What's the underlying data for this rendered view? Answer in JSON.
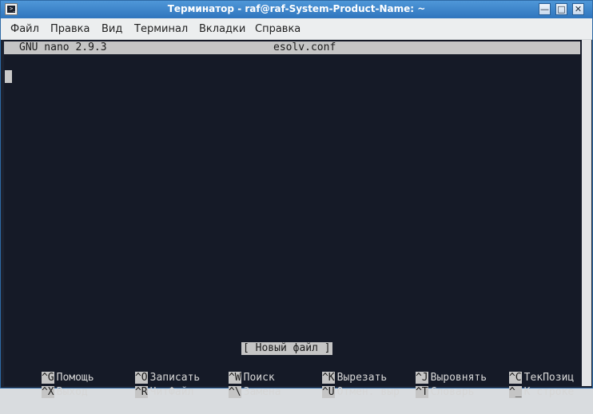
{
  "window": {
    "title": "Терминатор - raf@raf-System-Product-Name: ~",
    "app_icon_glyph": ">_",
    "buttons": {
      "minimize": "—",
      "maximize": "□",
      "close": "✕"
    }
  },
  "menubar": [
    "Файл",
    "Правка",
    "Вид",
    "Терминал",
    "Вкладки",
    "Справка"
  ],
  "nano": {
    "version": "GNU nano 2.9.3",
    "filename": "esolv.conf",
    "status": "[ Новый файл ]",
    "shortcuts_row1": [
      {
        "key": "^G",
        "label": "Помощь"
      },
      {
        "key": "^O",
        "label": "Записать"
      },
      {
        "key": "^W",
        "label": "Поиск"
      },
      {
        "key": "^K",
        "label": "Вырезать"
      },
      {
        "key": "^J",
        "label": "Выровнять"
      },
      {
        "key": "^C",
        "label": "ТекПозиц"
      }
    ],
    "shortcuts_row2": [
      {
        "key": "^X",
        "label": "Выход"
      },
      {
        "key": "^R",
        "label": "ЧитФайл"
      },
      {
        "key": "^\\",
        "label": "Замена"
      },
      {
        "key": "^U",
        "label": "Отмен. выр"
      },
      {
        "key": "^T",
        "label": "Словарь"
      },
      {
        "key": "^_",
        "label": "К строке"
      }
    ]
  },
  "colors": {
    "terminal_bg": "#151a27",
    "titlebar": "#3b82c9",
    "header_bg": "#c5c5c5"
  }
}
